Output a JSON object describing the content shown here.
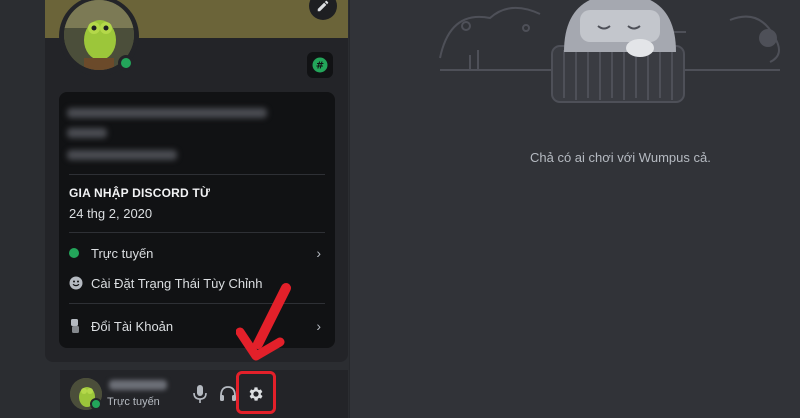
{
  "profile": {
    "section_title": "GIA NHẬP DISCORD TỪ",
    "join_date": "24 thg 2, 2020"
  },
  "menu": {
    "items": [
      {
        "label": "Trực tuyến",
        "icon": "online-dot-icon"
      },
      {
        "label": "Cài Đặt Trạng Thái Tùy Chỉnh",
        "icon": "smiley-icon"
      },
      {
        "label": "Đổi Tài Khoản",
        "icon": "switch-account-icon"
      }
    ]
  },
  "user_panel": {
    "status": "Trực tuyến"
  },
  "main": {
    "empty_message": "Chả có ai chơi với Wumpus cả."
  },
  "colors": {
    "accent_online": "#23a55a",
    "highlight": "#e3202a",
    "banner": "#6b6439"
  }
}
